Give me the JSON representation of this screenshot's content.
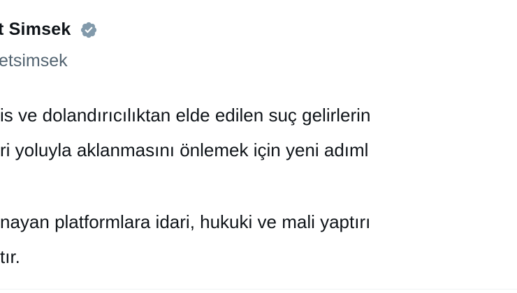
{
  "tweet": {
    "display_name": "t Simsek",
    "handle": "etsimsek",
    "verified_icon": "verified-badge-icon",
    "badge_color": "#829aab",
    "lines": [
      "is ve dolandırıcılıktan elde edilen suç gelirlerin",
      "ri yoluyla aklanmasını önlemek için yeni adıml",
      "nayan platformlara idari, hukuki ve mali yaptırı",
      "tır."
    ]
  }
}
